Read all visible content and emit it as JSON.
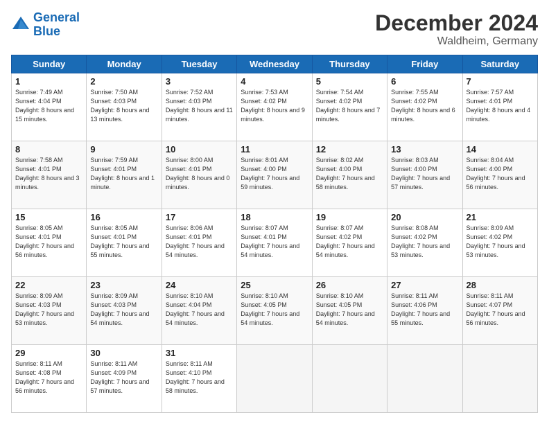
{
  "header": {
    "logo_line1": "General",
    "logo_line2": "Blue",
    "month_title": "December 2024",
    "location": "Waldheim, Germany"
  },
  "weekdays": [
    "Sunday",
    "Monday",
    "Tuesday",
    "Wednesday",
    "Thursday",
    "Friday",
    "Saturday"
  ],
  "weeks": [
    [
      {
        "day": "1",
        "rise": "Sunrise: 7:49 AM",
        "set": "Sunset: 4:04 PM",
        "light": "Daylight: 8 hours and 15 minutes."
      },
      {
        "day": "2",
        "rise": "Sunrise: 7:50 AM",
        "set": "Sunset: 4:03 PM",
        "light": "Daylight: 8 hours and 13 minutes."
      },
      {
        "day": "3",
        "rise": "Sunrise: 7:52 AM",
        "set": "Sunset: 4:03 PM",
        "light": "Daylight: 8 hours and 11 minutes."
      },
      {
        "day": "4",
        "rise": "Sunrise: 7:53 AM",
        "set": "Sunset: 4:02 PM",
        "light": "Daylight: 8 hours and 9 minutes."
      },
      {
        "day": "5",
        "rise": "Sunrise: 7:54 AM",
        "set": "Sunset: 4:02 PM",
        "light": "Daylight: 8 hours and 7 minutes."
      },
      {
        "day": "6",
        "rise": "Sunrise: 7:55 AM",
        "set": "Sunset: 4:02 PM",
        "light": "Daylight: 8 hours and 6 minutes."
      },
      {
        "day": "7",
        "rise": "Sunrise: 7:57 AM",
        "set": "Sunset: 4:01 PM",
        "light": "Daylight: 8 hours and 4 minutes."
      }
    ],
    [
      {
        "day": "8",
        "rise": "Sunrise: 7:58 AM",
        "set": "Sunset: 4:01 PM",
        "light": "Daylight: 8 hours and 3 minutes."
      },
      {
        "day": "9",
        "rise": "Sunrise: 7:59 AM",
        "set": "Sunset: 4:01 PM",
        "light": "Daylight: 8 hours and 1 minute."
      },
      {
        "day": "10",
        "rise": "Sunrise: 8:00 AM",
        "set": "Sunset: 4:01 PM",
        "light": "Daylight: 8 hours and 0 minutes."
      },
      {
        "day": "11",
        "rise": "Sunrise: 8:01 AM",
        "set": "Sunset: 4:00 PM",
        "light": "Daylight: 7 hours and 59 minutes."
      },
      {
        "day": "12",
        "rise": "Sunrise: 8:02 AM",
        "set": "Sunset: 4:00 PM",
        "light": "Daylight: 7 hours and 58 minutes."
      },
      {
        "day": "13",
        "rise": "Sunrise: 8:03 AM",
        "set": "Sunset: 4:00 PM",
        "light": "Daylight: 7 hours and 57 minutes."
      },
      {
        "day": "14",
        "rise": "Sunrise: 8:04 AM",
        "set": "Sunset: 4:00 PM",
        "light": "Daylight: 7 hours and 56 minutes."
      }
    ],
    [
      {
        "day": "15",
        "rise": "Sunrise: 8:05 AM",
        "set": "Sunset: 4:01 PM",
        "light": "Daylight: 7 hours and 56 minutes."
      },
      {
        "day": "16",
        "rise": "Sunrise: 8:05 AM",
        "set": "Sunset: 4:01 PM",
        "light": "Daylight: 7 hours and 55 minutes."
      },
      {
        "day": "17",
        "rise": "Sunrise: 8:06 AM",
        "set": "Sunset: 4:01 PM",
        "light": "Daylight: 7 hours and 54 minutes."
      },
      {
        "day": "18",
        "rise": "Sunrise: 8:07 AM",
        "set": "Sunset: 4:01 PM",
        "light": "Daylight: 7 hours and 54 minutes."
      },
      {
        "day": "19",
        "rise": "Sunrise: 8:07 AM",
        "set": "Sunset: 4:02 PM",
        "light": "Daylight: 7 hours and 54 minutes."
      },
      {
        "day": "20",
        "rise": "Sunrise: 8:08 AM",
        "set": "Sunset: 4:02 PM",
        "light": "Daylight: 7 hours and 53 minutes."
      },
      {
        "day": "21",
        "rise": "Sunrise: 8:09 AM",
        "set": "Sunset: 4:02 PM",
        "light": "Daylight: 7 hours and 53 minutes."
      }
    ],
    [
      {
        "day": "22",
        "rise": "Sunrise: 8:09 AM",
        "set": "Sunset: 4:03 PM",
        "light": "Daylight: 7 hours and 53 minutes."
      },
      {
        "day": "23",
        "rise": "Sunrise: 8:09 AM",
        "set": "Sunset: 4:03 PM",
        "light": "Daylight: 7 hours and 54 minutes."
      },
      {
        "day": "24",
        "rise": "Sunrise: 8:10 AM",
        "set": "Sunset: 4:04 PM",
        "light": "Daylight: 7 hours and 54 minutes."
      },
      {
        "day": "25",
        "rise": "Sunrise: 8:10 AM",
        "set": "Sunset: 4:05 PM",
        "light": "Daylight: 7 hours and 54 minutes."
      },
      {
        "day": "26",
        "rise": "Sunrise: 8:10 AM",
        "set": "Sunset: 4:05 PM",
        "light": "Daylight: 7 hours and 54 minutes."
      },
      {
        "day": "27",
        "rise": "Sunrise: 8:11 AM",
        "set": "Sunset: 4:06 PM",
        "light": "Daylight: 7 hours and 55 minutes."
      },
      {
        "day": "28",
        "rise": "Sunrise: 8:11 AM",
        "set": "Sunset: 4:07 PM",
        "light": "Daylight: 7 hours and 56 minutes."
      }
    ],
    [
      {
        "day": "29",
        "rise": "Sunrise: 8:11 AM",
        "set": "Sunset: 4:08 PM",
        "light": "Daylight: 7 hours and 56 minutes."
      },
      {
        "day": "30",
        "rise": "Sunrise: 8:11 AM",
        "set": "Sunset: 4:09 PM",
        "light": "Daylight: 7 hours and 57 minutes."
      },
      {
        "day": "31",
        "rise": "Sunrise: 8:11 AM",
        "set": "Sunset: 4:10 PM",
        "light": "Daylight: 7 hours and 58 minutes."
      },
      null,
      null,
      null,
      null
    ]
  ]
}
